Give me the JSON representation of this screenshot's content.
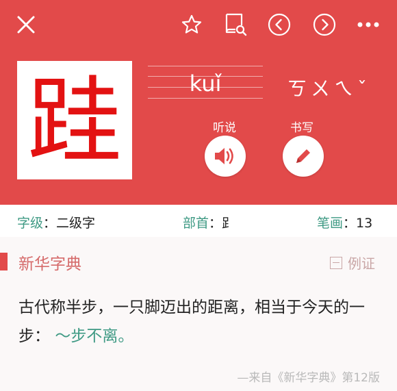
{
  "header": {
    "icons": [
      "close-icon",
      "star-icon",
      "book-search-icon",
      "chevron-left-icon",
      "chevron-right-icon",
      "more-icon"
    ],
    "accent_color": "#e24a4a"
  },
  "character": {
    "glyph": "跬",
    "pinyin": "kuǐ",
    "zhuyin": "ㄎㄨㄟˇ"
  },
  "actions": {
    "listen_label": "听说",
    "write_label": "书写"
  },
  "info": {
    "level_key": "字级",
    "level_value": "二级字",
    "radical_key": "部首",
    "radical_value": "𧾷",
    "strokes_key": "笔画",
    "strokes_value": "13",
    "separator": "："
  },
  "section": {
    "title": "新华字典",
    "example_label": "例证"
  },
  "definition": {
    "text": "古代称半步，一只脚迈出的距离，相当于今天的一步：",
    "example": "～步不离。"
  },
  "source": "—来自《新华字典》第12版"
}
